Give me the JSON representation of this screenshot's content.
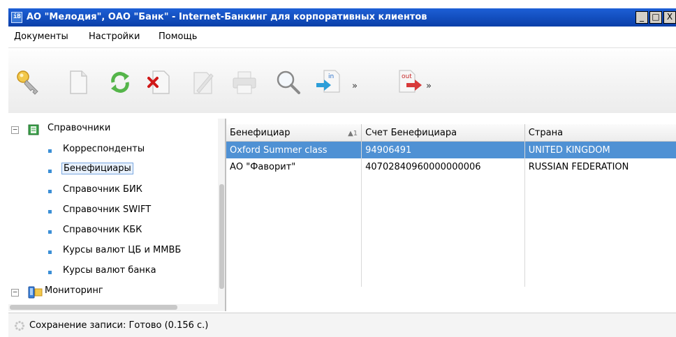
{
  "window": {
    "title": "АО \"Мелодия\", ОАО \"Банк\" - Internet-Банкинг для корпоративных клиентов",
    "app_icon_text": "iB",
    "minimize": "_",
    "restore": "□",
    "close": "X"
  },
  "menu": [
    "Документы",
    "Настройки",
    "Помощь"
  ],
  "toolbar": {
    "icons": [
      "key-icon",
      "new-document-icon",
      "refresh-icon",
      "delete-document-icon",
      "edit-document-icon",
      "print-icon",
      "search-icon",
      "import-in-icon",
      "export-out-icon"
    ],
    "in_label": "in",
    "out_label": "out",
    "more_glyph": "»"
  },
  "tree": {
    "group1": {
      "label": "Справочники",
      "expander": "−"
    },
    "items": [
      "Корреспонденты",
      "Бенефициары",
      "Справочник БИК",
      "Справочник SWIFT",
      "Справочник КБК",
      "Курсы валют ЦБ и ММВБ",
      "Курсы валют банка"
    ],
    "selected": "Бенефициары",
    "group2": {
      "label": "Мониторинг",
      "expander": "−"
    }
  },
  "grid": {
    "columns": [
      {
        "label": "Бенефициар",
        "sort": "▲1"
      },
      {
        "label": "Счет Бенефициара"
      },
      {
        "label": "Страна"
      }
    ],
    "rows": [
      {
        "name": "Oxford Summer class",
        "account": "94906491",
        "country": "UNITED KINGDOM",
        "selected": true
      },
      {
        "name": "АО \"Фаворит\"",
        "account": "40702840960000000006",
        "country": "RUSSIAN FEDERATION",
        "selected": false
      }
    ]
  },
  "status": {
    "text": "Сохранение записи: Готово (0.156 с.)"
  },
  "colors": {
    "titlebar": "#0a3fa8",
    "selection": "#4f91d4",
    "bullet": "#3b8fd6"
  }
}
